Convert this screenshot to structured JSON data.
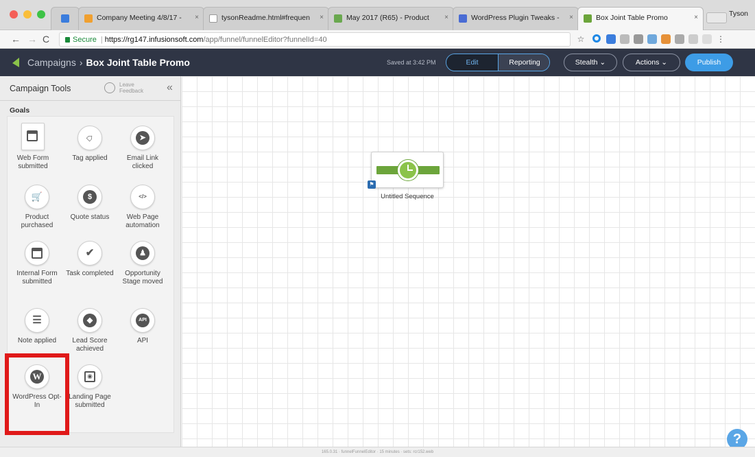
{
  "browser": {
    "tabs": [
      {
        "title": "Company Meeting 4/8/17 - ",
        "favicon_color": "#f0a030"
      },
      {
        "title": "tysonReadme.html#frequen",
        "favicon_color": "#ffffff"
      },
      {
        "title": "May 2017 (R65) - Product",
        "favicon_color": "#6aa84f"
      },
      {
        "title": "WordPress Plugin Tweaks -",
        "favicon_color": "#4a6cd4"
      },
      {
        "title": "Box Joint Table Promo",
        "favicon_color": "#6ca53b"
      }
    ],
    "profile": "Tyson",
    "address": {
      "secure_label": "Secure",
      "host": "https://rg147.infusionsoft.com",
      "path": "/app/funnel/funnelEditor?funnelId=40"
    }
  },
  "app": {
    "breadcrumb": {
      "parent": "Campaigns",
      "separator": "›",
      "current": "Box Joint Table Promo"
    },
    "saved_status": "Saved at 3:42 PM",
    "modes": {
      "edit": "Edit",
      "reporting": "Reporting"
    },
    "stealth_label": "Stealth ⌄",
    "actions_label": "Actions ⌄",
    "publish_label": "Publish"
  },
  "sidebar": {
    "title": "Campaign Tools",
    "feedback_label": "Leave Feedback",
    "collapse_glyph": "«",
    "section_label": "Goals",
    "goals": [
      {
        "label": "Web Form submitted",
        "icon": "web-form-icon"
      },
      {
        "label": "Tag applied",
        "icon": "tag-icon"
      },
      {
        "label": "Email Link clicked",
        "icon": "cursor-icon"
      },
      {
        "label": "Product purchased",
        "icon": "cart-icon"
      },
      {
        "label": "Quote status",
        "icon": "dollar-icon"
      },
      {
        "label": "Web Page automation",
        "icon": "code-icon"
      },
      {
        "label": "Internal Form submitted",
        "icon": "internal-form-icon"
      },
      {
        "label": "Task completed",
        "icon": "check-icon"
      },
      {
        "label": "Opportunity Stage moved",
        "icon": "opportunity-icon"
      },
      {
        "label": "Note applied",
        "icon": "note-icon"
      },
      {
        "label": "Lead Score achieved",
        "icon": "flame-icon"
      },
      {
        "label": "API",
        "icon": "api-icon"
      },
      {
        "label": "WordPress Opt-In",
        "icon": "wordpress-icon"
      },
      {
        "label": "Landing Page submitted",
        "icon": "landing-page-icon"
      }
    ],
    "glyphs": {
      "tag": "⌂",
      "cursor": "➤",
      "cart": "🛒",
      "dollar": "$",
      "code": "</>",
      "check": "✔",
      "person": "♟",
      "note": "☰",
      "flame": "◆",
      "api": "API",
      "wp": "W",
      "landing": "◉"
    }
  },
  "canvas": {
    "sequence_label": "Untitled Sequence"
  },
  "help_label": "?",
  "footer_text": "165.0.31 · funnelFunnelEditor · 15 minutes · sets: rcr152.web"
}
